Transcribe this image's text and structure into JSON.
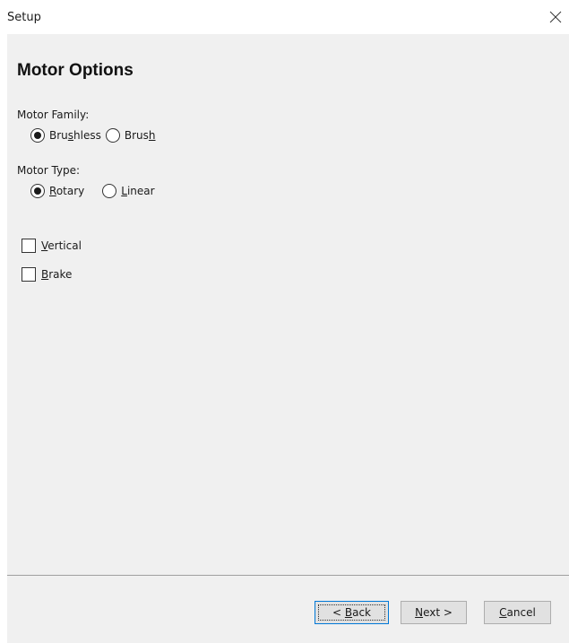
{
  "window": {
    "title": "Setup"
  },
  "page": {
    "heading": "Motor Options"
  },
  "motor_family": {
    "label": "Motor Family:",
    "options": [
      {
        "pre": "Bru",
        "mnemonic": "s",
        "post": "hless",
        "selected": true
      },
      {
        "pre": "Brus",
        "mnemonic": "h",
        "post": "",
        "selected": false
      }
    ]
  },
  "motor_type": {
    "label": "Motor Type:",
    "options": [
      {
        "pre": "",
        "mnemonic": "R",
        "post": "otary",
        "selected": true
      },
      {
        "pre": "",
        "mnemonic": "L",
        "post": "inear",
        "selected": false
      }
    ]
  },
  "checkboxes": [
    {
      "pre": "",
      "mnemonic": "V",
      "post": "ertical",
      "checked": false
    },
    {
      "pre": "",
      "mnemonic": "B",
      "post": "rake",
      "checked": false
    }
  ],
  "footer": {
    "back": {
      "pre": "< ",
      "mnemonic": "B",
      "post": "ack"
    },
    "next": {
      "pre": "",
      "mnemonic": "N",
      "post": "ext >"
    },
    "cancel": {
      "pre": "",
      "mnemonic": "C",
      "post": "ancel"
    }
  },
  "icons": {
    "close": "close-icon"
  },
  "colors": {
    "panel": "#f0f0f0",
    "button": "#e1e1e1",
    "default_button_border": "#0078d7"
  }
}
